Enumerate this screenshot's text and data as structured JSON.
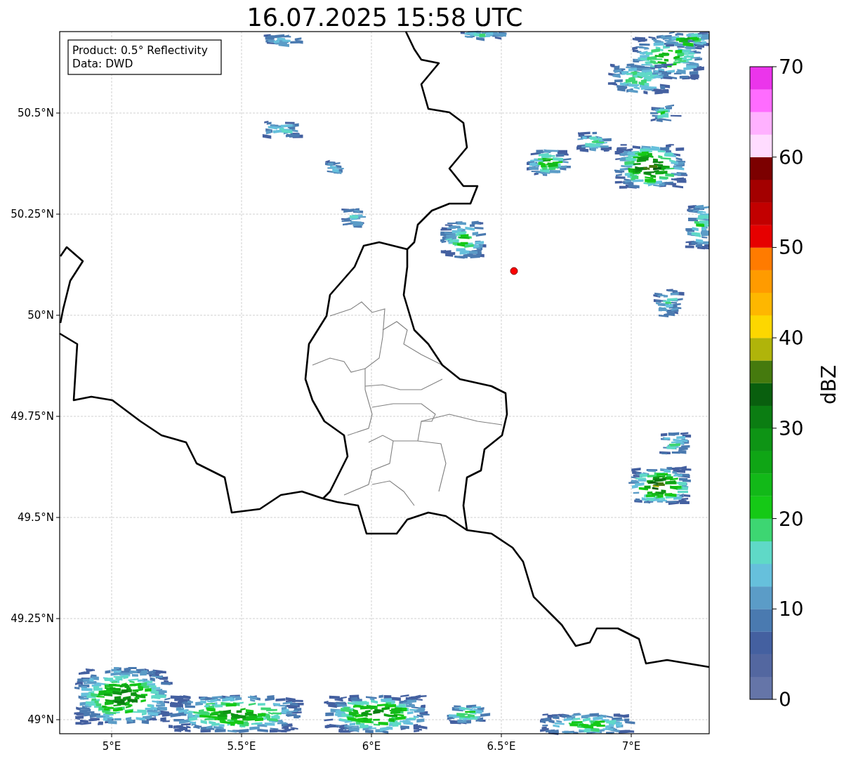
{
  "title": "16.07.2025 15:58 UTC",
  "info": [
    "Product: 0.5° Reflectivity",
    "Data: DWD"
  ],
  "map": {
    "xticks": [
      "5°E",
      "5.5°E",
      "6°E",
      "6.5°E",
      "7°E"
    ],
    "yticks": [
      "50.5°N",
      "50.25°N",
      "50°N",
      "49.75°N",
      "49.5°N",
      "49.25°N",
      "49°N"
    ]
  },
  "colorbar": {
    "label": "dBZ",
    "ticks": [
      "70",
      "60",
      "50",
      "40",
      "30",
      "20",
      "10",
      "0"
    ],
    "bins": [
      {
        "color": "#6575a8"
      },
      {
        "color": "#5367a0"
      },
      {
        "color": "#4460a0"
      },
      {
        "color": "#4a7ab0"
      },
      {
        "color": "#5b9cc7"
      },
      {
        "color": "#66c0dc"
      },
      {
        "color": "#5fd9c7"
      },
      {
        "color": "#3dd672"
      },
      {
        "color": "#15c916"
      },
      {
        "color": "#12b918"
      },
      {
        "color": "#0fa515"
      },
      {
        "color": "#0e9415"
      },
      {
        "color": "#0b7d12"
      },
      {
        "color": "#095f0e"
      },
      {
        "color": "#457a0e"
      },
      {
        "color": "#b0b40a"
      },
      {
        "color": "#fdd700"
      },
      {
        "color": "#feb700"
      },
      {
        "color": "#ff9b00"
      },
      {
        "color": "#ff7b00"
      },
      {
        "color": "#e60000"
      },
      {
        "color": "#c20000"
      },
      {
        "color": "#a30000"
      },
      {
        "color": "#7c0000"
      },
      {
        "color": "#ffdcff"
      },
      {
        "color": "#ffb1ff"
      },
      {
        "color": "#ff6cff"
      },
      {
        "color": "#eb35eb"
      }
    ]
  }
}
